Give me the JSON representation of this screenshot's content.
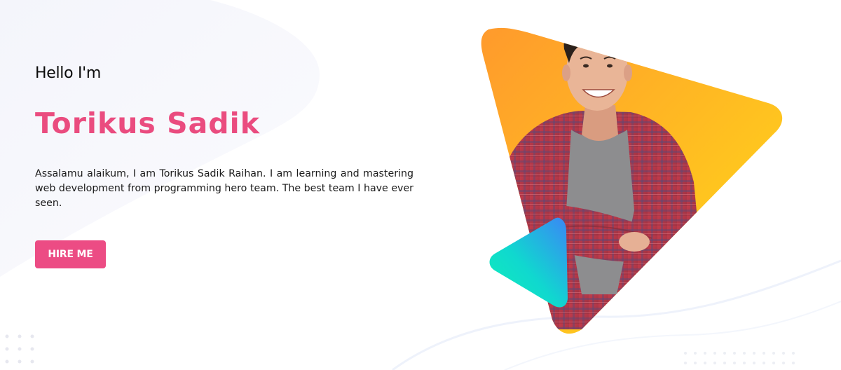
{
  "hero": {
    "greeting": "Hello I'm",
    "name": "Torikus Sadik",
    "bio": "Assalamu alaikum, I am Torikus Sadik Raihan. I am learning and mastering web development from programming hero team. The best team I have ever seen.",
    "hire_label": "HIRE ME"
  },
  "colors": {
    "accent": "#ea4c7f",
    "button": "#ec4c84",
    "triangle_orange": "#ffa02b",
    "triangle_yellow": "#ffd81d",
    "play_teal": "#0ee8c2",
    "play_blue": "#3b8cf5",
    "shirt_red": "#c2424f",
    "tee_gray": "#8e8e8e"
  },
  "icons": {
    "play": "play-triangle-icon"
  }
}
